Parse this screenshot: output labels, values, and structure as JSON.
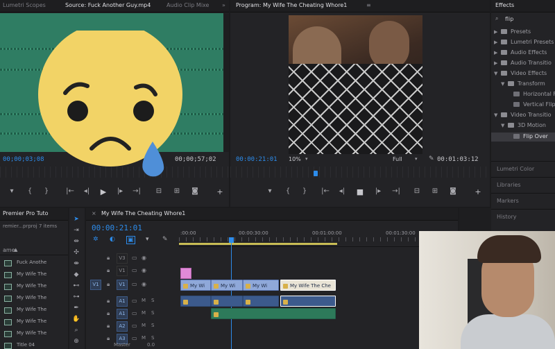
{
  "source": {
    "tabs": [
      "Lumetri Scopes",
      "Source: Fuck Another Guy.mp4",
      "Audio Clip Mixe"
    ],
    "more": "»",
    "timecode_left": "00;00;03;08",
    "timecode_right": "00;00;57;02"
  },
  "program": {
    "tab": "Program: My Wife The Cheating Whore1",
    "menu": "≡",
    "timecode_left": "00:00:21:01",
    "zoom": "10%",
    "quality": "Full",
    "timecode_right": "00:01:03:12"
  },
  "effects": {
    "tab": "Effects",
    "search_value": "flip",
    "tree": [
      {
        "label": "Presets",
        "depth": 0,
        "kind": "folder",
        "open": false
      },
      {
        "label": "Lumetri Presets",
        "depth": 0,
        "kind": "folder",
        "open": false
      },
      {
        "label": "Audio Effects",
        "depth": 0,
        "kind": "folder",
        "open": false
      },
      {
        "label": "Audio Transitio",
        "depth": 0,
        "kind": "folder",
        "open": false
      },
      {
        "label": "Video Effects",
        "depth": 0,
        "kind": "folder",
        "open": true
      },
      {
        "label": "Transform",
        "depth": 1,
        "kind": "folder",
        "open": true
      },
      {
        "label": "Horizontal F",
        "depth": 2,
        "kind": "effect",
        "open": false
      },
      {
        "label": "Vertical Flip",
        "depth": 2,
        "kind": "effect",
        "open": false
      },
      {
        "label": "Video Transitio",
        "depth": 0,
        "kind": "folder",
        "open": true
      },
      {
        "label": "3D Motion",
        "depth": 1,
        "kind": "folder",
        "open": true
      },
      {
        "label": "Flip Over",
        "depth": 2,
        "kind": "effect",
        "open": false
      }
    ],
    "sections": [
      "Lumetri Color",
      "Libraries",
      "Markers",
      "History"
    ]
  },
  "project": {
    "tab": "Premier Pro Tuto",
    "file": "remier...prproj",
    "items_count": "7 items",
    "column": "ame",
    "items": [
      "Fuck Anothe",
      "My Wife The",
      "My Wife The",
      "My Wife The",
      "My Wife The",
      "My Wife The",
      "My Wife The",
      "Title 04"
    ]
  },
  "timeline": {
    "tab": "My Wife The Cheating Whore1",
    "timecode": "00:00:21:01",
    "ruler": [
      ":00:00",
      "00:00:30:00",
      "00:01:00:00",
      "00:01:30:00"
    ],
    "tracks": [
      {
        "target": "",
        "name": "V3",
        "kind": "video"
      },
      {
        "target": "",
        "name": "V1",
        "kind": "video"
      },
      {
        "target": "V1",
        "name": "V1",
        "kind": "video"
      },
      {
        "target": "",
        "name": "A1",
        "kind": "audio",
        "m": "M",
        "s": "S"
      },
      {
        "target": "",
        "name": "A1",
        "kind": "audio",
        "m": "M",
        "s": "S"
      },
      {
        "target": "",
        "name": "A2",
        "kind": "audio",
        "m": "M",
        "s": "S"
      },
      {
        "target": "",
        "name": "A3",
        "kind": "audio",
        "m": "M",
        "s": "S"
      }
    ],
    "master_label": "Master",
    "master_value": "0.0",
    "clips": {
      "v1_a": "My Wi",
      "v1_b": "My Wi",
      "v1_c": "My Wi",
      "v1_d": "My Wife The Che"
    }
  },
  "colors": {
    "accent_blue": "#2d8ceb",
    "source_green": "#2f7d63",
    "emoji_yellow": "#f2d366",
    "tear_blue": "#4f8fd8",
    "title_pink": "#e08ad8"
  }
}
